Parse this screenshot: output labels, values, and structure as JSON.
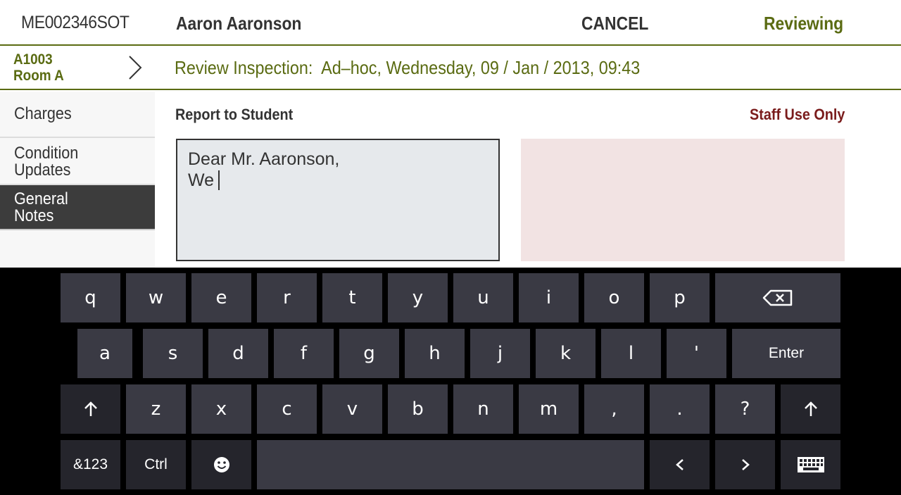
{
  "header": {
    "record_id": "ME002346SOT",
    "student_name": "Aaron Aaronson",
    "cancel_label": "CANCEL",
    "status": "Reviewing"
  },
  "subheader": {
    "room_code": "A1003",
    "room_name": "Room A",
    "title": "Review Inspection:  Ad–hoc, Wednesday, 09 / Jan / 2013, 09:43"
  },
  "sidebar": {
    "items": [
      {
        "label": "Charges",
        "active": false
      },
      {
        "label": "Condition\nUpdates",
        "active": false
      },
      {
        "label": "General\nNotes",
        "active": true
      }
    ]
  },
  "main": {
    "report_title": "Report to Student",
    "staff_title": "Staff Use Only",
    "report_text": "Dear Mr. Aaronson,\nWe",
    "staff_text": ""
  },
  "colors": {
    "accent": "#5a6b12",
    "staff_accent": "#7a1c1c",
    "report_bg": "#e6e9ec",
    "staff_bg": "#f2e3e3",
    "key_bg": "#3a3a44"
  },
  "keyboard": {
    "row1": [
      "q",
      "w",
      "e",
      "r",
      "t",
      "y",
      "u",
      "i",
      "o",
      "p"
    ],
    "row2": [
      "a",
      "s",
      "d",
      "f",
      "g",
      "h",
      "j",
      "k",
      "l",
      "'"
    ],
    "row3": [
      "z",
      "x",
      "c",
      "v",
      "b",
      "n",
      "m",
      ",",
      ".",
      "?"
    ],
    "enter_label": "Enter",
    "symbols_label": "&123",
    "ctrl_label": "Ctrl",
    "icons": {
      "backspace": "backspace-icon",
      "shift": "shift-arrow-icon",
      "emoji": "emoji-icon",
      "left": "arrow-left-icon",
      "right": "arrow-right-icon",
      "keyboard": "keyboard-icon"
    }
  }
}
